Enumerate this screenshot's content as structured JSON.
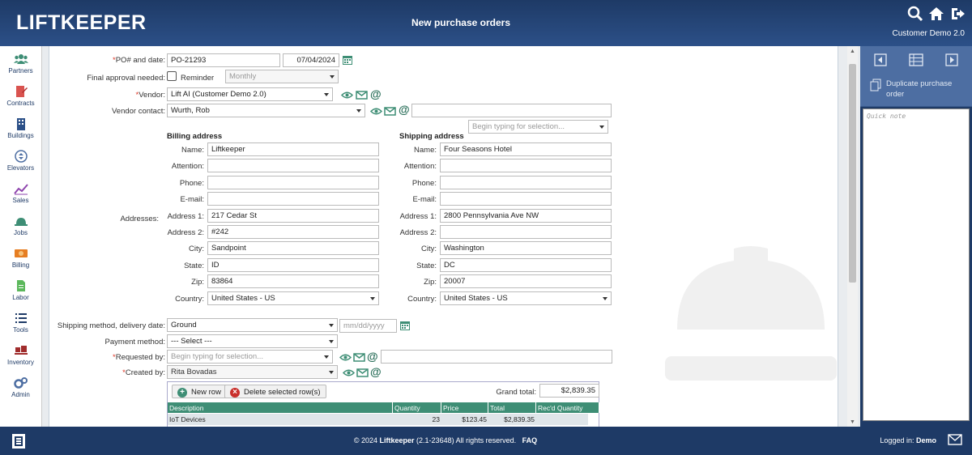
{
  "header": {
    "logo": "LIFTKEEPER",
    "title": "New purchase orders",
    "org": "Customer Demo 2.0"
  },
  "nav": [
    {
      "label": "Partners",
      "icon": "partners-icon"
    },
    {
      "label": "Contracts",
      "icon": "contracts-icon"
    },
    {
      "label": "Buildings",
      "icon": "buildings-icon"
    },
    {
      "label": "Elevators",
      "icon": "elevators-icon"
    },
    {
      "label": "Sales",
      "icon": "sales-icon"
    },
    {
      "label": "Jobs",
      "icon": "jobs-icon"
    },
    {
      "label": "Billing",
      "icon": "billing-icon"
    },
    {
      "label": "Labor",
      "icon": "labor-icon"
    },
    {
      "label": "Tools",
      "icon": "tools-icon"
    },
    {
      "label": "Inventory",
      "icon": "inventory-icon"
    },
    {
      "label": "Admin",
      "icon": "admin-icon"
    }
  ],
  "form": {
    "po_label": "PO# and date:",
    "po_number": "PO-21293",
    "po_date": "07/04/2024",
    "final_approval_label": "Final approval needed:",
    "reminder_label": "Reminder",
    "reminder_freq": "Monthly",
    "vendor_label": "Vendor:",
    "vendor": "Lift AI (Customer Demo 2.0)",
    "vendor_contact_label": "Vendor contact:",
    "vendor_contact": "Wurth, Rob",
    "vendor_contact_email": "",
    "cc_placeholder": "Begin typing for selection...",
    "addresses_label": "Addresses:",
    "field_labels": {
      "name": "Name:",
      "attention": "Attention:",
      "phone": "Phone:",
      "email": "E-mail:",
      "address1": "Address 1:",
      "address2": "Address 2:",
      "city": "City:",
      "state": "State:",
      "zip": "Zip:",
      "country": "Country:"
    },
    "billing": {
      "heading": "Billing address",
      "name": "Liftkeeper",
      "attention": "",
      "phone": "",
      "email": "",
      "address1": "217 Cedar St",
      "address2": "#242",
      "city": "Sandpoint",
      "state": "ID",
      "zip": "83864",
      "country": "United States - US"
    },
    "shipping": {
      "heading": "Shipping address",
      "name": "Four Seasons Hotel",
      "attention": "",
      "phone": "",
      "email": "",
      "address1": "2800 Pennsylvania Ave NW",
      "address2": "",
      "city": "Washington",
      "state": "DC",
      "zip": "20007",
      "country": "United States - US"
    },
    "shipping_method_label": "Shipping method, delivery date:",
    "shipping_method": "Ground",
    "delivery_placeholder": "mm/dd/yyyy",
    "payment_label": "Payment method:",
    "payment": "--- Select ---",
    "requested_label": "Requested by:",
    "requested_placeholder": "Begin typing for selection...",
    "created_label": "Created by:",
    "created_by": "Rita Bovadas"
  },
  "items": {
    "new_row": "New row",
    "delete_rows": "Delete selected row(s)",
    "grand_total_label": "Grand total:",
    "grand_total": "$2,839.35",
    "columns": [
      "Description",
      "Quantity",
      "Price",
      "Total",
      "Rec'd Quantity"
    ],
    "rows": [
      {
        "description": "IoT Devices",
        "quantity": "23",
        "price": "$123.45",
        "total": "$2,839.35",
        "recd": ""
      }
    ]
  },
  "right_panel": {
    "duplicate": "Duplicate purchase order",
    "quick_note_placeholder": "Quick note"
  },
  "footer": {
    "copyright_pre": "© 2024",
    "brand": "Liftkeeper",
    "copyright_post": "(2.1-23648) All rights reserved.",
    "faq": "FAQ",
    "logged_in_label": "Logged in:",
    "user": "Demo"
  },
  "colors": {
    "header": "#1e3a66",
    "accent_green": "#3e8e75",
    "required": "#dd3322"
  }
}
